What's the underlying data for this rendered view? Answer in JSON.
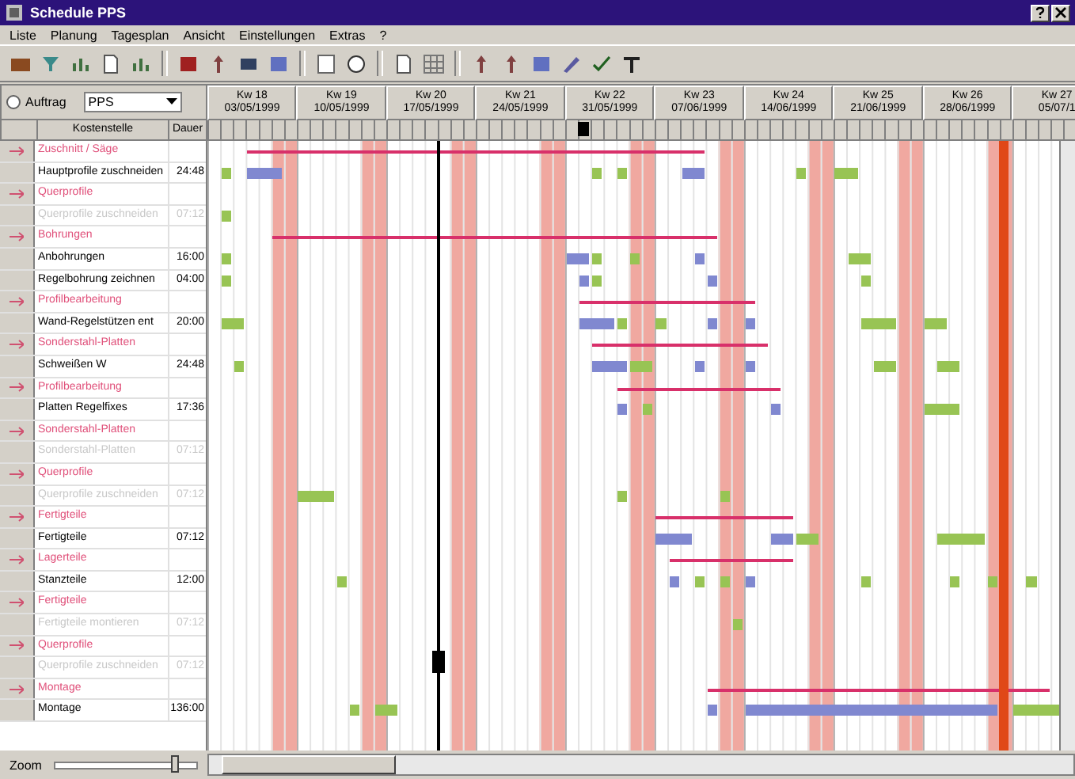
{
  "window": {
    "title": "Schedule PPS"
  },
  "menu": [
    "Liste",
    "Planung",
    "Tagesplan",
    "Ansicht",
    "Einstellungen",
    "Extras",
    "?"
  ],
  "filter": {
    "label": "Auftrag",
    "value": "PPS",
    "selected": false
  },
  "columns": [
    "Kostenstelle",
    "Dauer"
  ],
  "weeks": [
    {
      "label": "Kw 18",
      "date": "03/05/1999"
    },
    {
      "label": "Kw 19",
      "date": "10/05/1999"
    },
    {
      "label": "Kw 20",
      "date": "17/05/1999"
    },
    {
      "label": "Kw 21",
      "date": "24/05/1999"
    },
    {
      "label": "Kw 22",
      "date": "31/05/1999"
    },
    {
      "label": "Kw 23",
      "date": "07/06/1999"
    },
    {
      "label": "Kw 24",
      "date": "14/06/1999"
    },
    {
      "label": "Kw 25",
      "date": "21/06/1999"
    },
    {
      "label": "Kw 26",
      "date": "28/06/1999"
    },
    {
      "label": "Kw 27",
      "date": "05/07/1"
    }
  ],
  "rows": [
    {
      "kind": "group",
      "label": "Zuschnitt / Säge"
    },
    {
      "kind": "task",
      "label": "Hauptprofile zuschneiden",
      "duration": "24:48"
    },
    {
      "kind": "group",
      "label": "Querprofile"
    },
    {
      "kind": "pending",
      "label": "Querprofile zuschneiden",
      "duration": "07:12"
    },
    {
      "kind": "group",
      "label": "Bohrungen"
    },
    {
      "kind": "task",
      "label": "Anbohrungen",
      "duration": "16:00"
    },
    {
      "kind": "task",
      "label": "Regelbohrung zeichnen",
      "duration": "04:00"
    },
    {
      "kind": "group",
      "label": "Profilbearbeitung"
    },
    {
      "kind": "task",
      "label": "Wand-Regelstützen ent",
      "duration": "20:00"
    },
    {
      "kind": "group",
      "label": "Sonderstahl-Platten"
    },
    {
      "kind": "task",
      "label": "Schweißen W",
      "duration": "24:48"
    },
    {
      "kind": "group",
      "label": "Profilbearbeitung"
    },
    {
      "kind": "task",
      "label": "Platten Regelfixes",
      "duration": "17:36"
    },
    {
      "kind": "group",
      "label": "Sonderstahl-Platten"
    },
    {
      "kind": "pending",
      "label": "Sonderstahl-Platten",
      "duration": "07:12"
    },
    {
      "kind": "group",
      "label": "Querprofile"
    },
    {
      "kind": "pending",
      "label": "Querprofile zuschneiden",
      "duration": "07:12"
    },
    {
      "kind": "group",
      "label": "Fertigteile"
    },
    {
      "kind": "task",
      "label": "Fertigteile",
      "duration": "07:12"
    },
    {
      "kind": "group",
      "label": "Lagerteile"
    },
    {
      "kind": "task",
      "label": "Stanzteile",
      "duration": "12:00"
    },
    {
      "kind": "group",
      "label": "Fertigteile"
    },
    {
      "kind": "pending",
      "label": "Fertigteile montieren",
      "duration": "07:12"
    },
    {
      "kind": "group",
      "label": "Querprofile"
    },
    {
      "kind": "pending",
      "label": "Querprofile zuschneiden",
      "duration": "07:12"
    },
    {
      "kind": "group",
      "label": "Montage"
    },
    {
      "kind": "task",
      "label": "Montage",
      "duration": "136:00"
    }
  ],
  "zoom": {
    "label": "Zoom",
    "level": 0.85
  }
}
